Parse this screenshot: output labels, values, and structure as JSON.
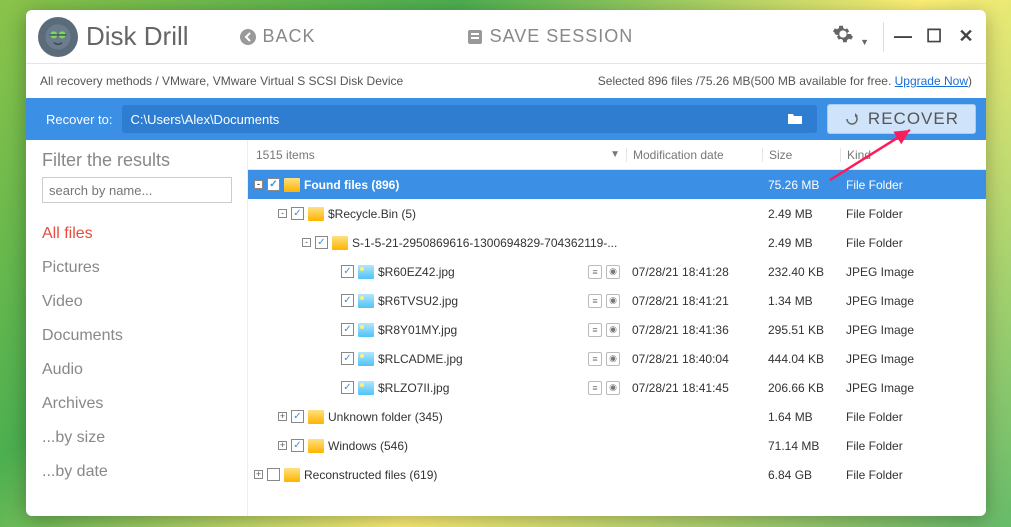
{
  "app": {
    "title": "Disk Drill"
  },
  "titlebar": {
    "back": "BACK",
    "save_session": "SAVE SESSION"
  },
  "subbar": {
    "breadcrumb": "All recovery methods / VMware, VMware Virtual S SCSI Disk Device",
    "selected_prefix": "Selected ",
    "selected_count": "896 files",
    "selected_size": " /75.26 MB",
    "free_info": "(500 MB available for free. ",
    "upgrade": "Upgrade Now",
    "close_paren": ")"
  },
  "recoverbar": {
    "label": "Recover to:",
    "path": "C:\\Users\\Alex\\Documents",
    "button": "RECOVER"
  },
  "sidebar": {
    "title": "Filter the results",
    "search_placeholder": "search by name...",
    "cats": [
      "All files",
      "Pictures",
      "Video",
      "Documents",
      "Audio",
      "Archives",
      "...by size",
      "...by date"
    ]
  },
  "columns": {
    "items_label": "1515 items",
    "mod": "Modification date",
    "size": "Size",
    "kind": "Kind"
  },
  "rows": [
    {
      "indent": 0,
      "exp": "-",
      "checked": true,
      "icon": "folder",
      "name": "Found files (896)",
      "mod": "",
      "size": "75.26 MB",
      "kind": "File Folder",
      "sel": true
    },
    {
      "indent": 1,
      "exp": "-",
      "checked": true,
      "icon": "folder",
      "name": "$Recycle.Bin (5)",
      "mod": "",
      "size": "2.49 MB",
      "kind": "File Folder"
    },
    {
      "indent": 2,
      "exp": "-",
      "checked": true,
      "icon": "folder",
      "name": "S-1-5-21-2950869616-1300694829-704362119-...",
      "mod": "",
      "size": "2.49 MB",
      "kind": "File Folder"
    },
    {
      "indent": 3,
      "exp": "",
      "checked": true,
      "icon": "img",
      "name": "$R60EZ42.jpg",
      "mod": "07/28/21 18:41:28",
      "size": "232.40 KB",
      "kind": "JPEG Image",
      "actions": true
    },
    {
      "indent": 3,
      "exp": "",
      "checked": true,
      "icon": "img",
      "name": "$R6TVSU2.jpg",
      "mod": "07/28/21 18:41:21",
      "size": "1.34 MB",
      "kind": "JPEG Image",
      "actions": true
    },
    {
      "indent": 3,
      "exp": "",
      "checked": true,
      "icon": "img",
      "name": "$R8Y01MY.jpg",
      "mod": "07/28/21 18:41:36",
      "size": "295.51 KB",
      "kind": "JPEG Image",
      "actions": true
    },
    {
      "indent": 3,
      "exp": "",
      "checked": true,
      "icon": "img",
      "name": "$RLCADME.jpg",
      "mod": "07/28/21 18:40:04",
      "size": "444.04 KB",
      "kind": "JPEG Image",
      "actions": true
    },
    {
      "indent": 3,
      "exp": "",
      "checked": true,
      "icon": "img",
      "name": "$RLZO7II.jpg",
      "mod": "07/28/21 18:41:45",
      "size": "206.66 KB",
      "kind": "JPEG Image",
      "actions": true
    },
    {
      "indent": 1,
      "exp": "+",
      "checked": true,
      "icon": "folder",
      "name": "Unknown folder (345)",
      "mod": "",
      "size": "1.64 MB",
      "kind": "File Folder"
    },
    {
      "indent": 1,
      "exp": "+",
      "checked": true,
      "icon": "folder",
      "name": "Windows (546)",
      "mod": "",
      "size": "71.14 MB",
      "kind": "File Folder"
    },
    {
      "indent": 0,
      "exp": "+",
      "checked": false,
      "icon": "folder",
      "name": "Reconstructed files (619)",
      "mod": "",
      "size": "6.84 GB",
      "kind": "File Folder"
    }
  ]
}
